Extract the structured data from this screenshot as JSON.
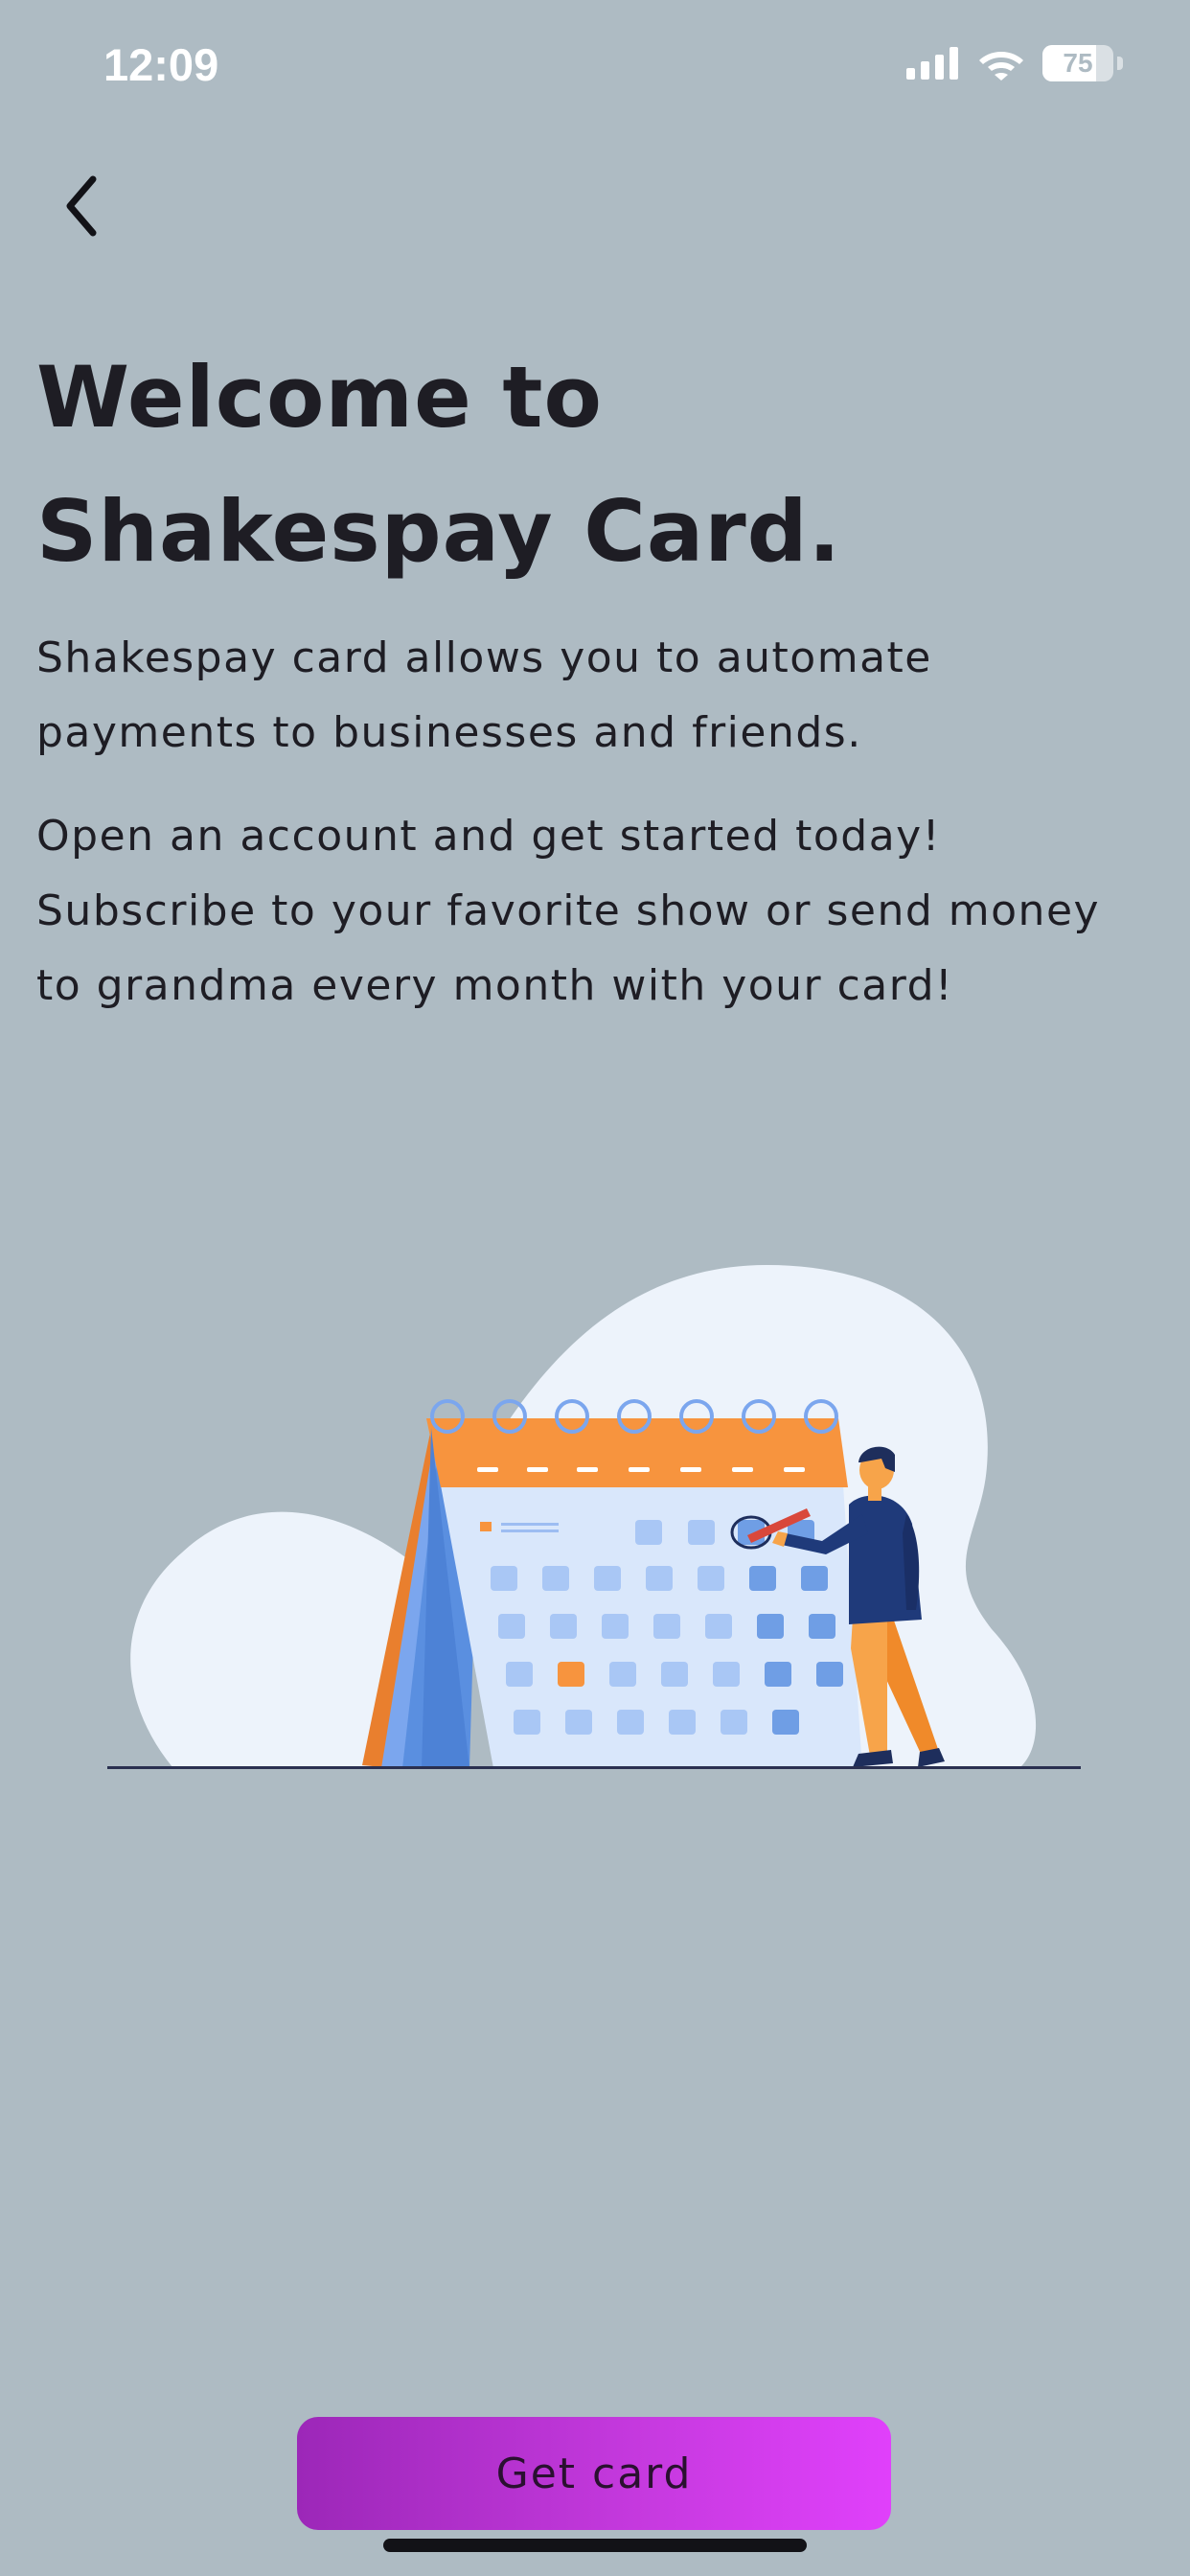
{
  "status_bar": {
    "time": "12:09",
    "battery_level": "75",
    "icons": [
      "cellular-signal-icon",
      "wifi-icon",
      "battery-icon"
    ]
  },
  "header": {
    "back_icon": "chevron-left-icon"
  },
  "content": {
    "title": "Welcome to Shakespay Card.",
    "paragraph_1": "Shakespay card allows you to automate payments to businesses and friends.",
    "paragraph_2": "Open an account and get started today! Subscribe to your favorite show or send money to grandma every month with your card!",
    "illustration": "calendar-scheduling-illustration"
  },
  "cta": {
    "label": "Get card"
  },
  "colors": {
    "background": "#aebbc3",
    "text": "#1e1d24",
    "button_gradient_start": "#9c27b8",
    "button_gradient_end": "#e040fb",
    "calendar_orange": "#f7943e",
    "calendar_blue": "#5a8fe0"
  }
}
